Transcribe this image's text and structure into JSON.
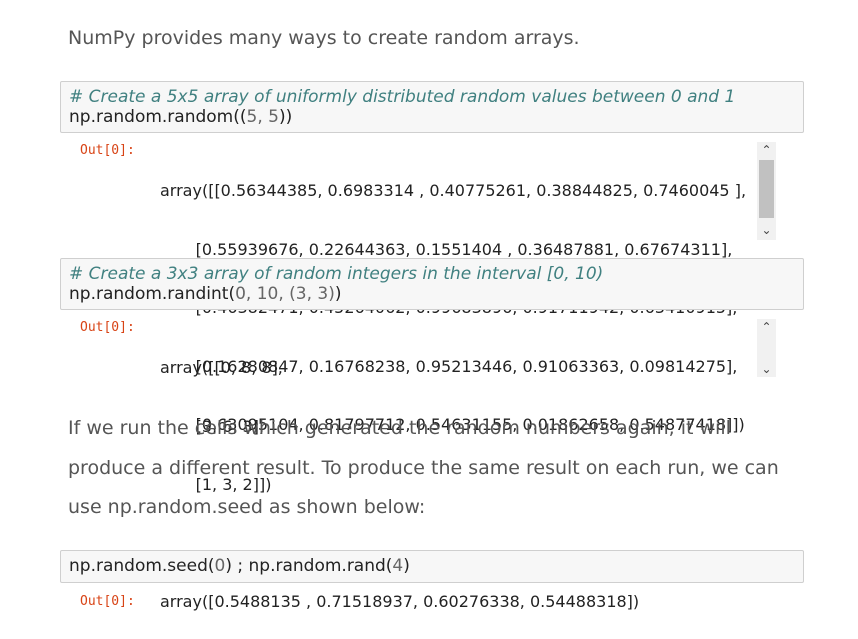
{
  "intro_text": "NumPy provides many ways to create random arrays.",
  "cell1": {
    "comment": "# Create a 5x5 array of uniformly distributed random values between 0 and 1",
    "code_prefix": "np.random.random((",
    "code_nums": "5, 5",
    "code_suffix": "))",
    "out_prompt": "Out[0]:",
    "output_lines": [
      "array([[0.56344385, 0.6983314 , 0.40775261, 0.38844825, 0.7460045 ],",
      "       [0.55939676, 0.22644363, 0.1551404 , 0.36487881, 0.67674311],",
      "       [0.46382471, 0.45264062, 0.99683896, 0.91711942, 0.63410915],",
      "       [0.16280847, 0.16768238, 0.95213446, 0.91063363, 0.09814275],",
      "       [0.63095104, 0.81797712, 0.54631155, 0.01862658, 0.54877418]])"
    ]
  },
  "cell2": {
    "comment": "# Create a 3x3 array of random integers in the interval [0, 10)",
    "code_prefix": "np.random.randint(",
    "code_nums": "0, 10, (3, 3)",
    "code_suffix": ")",
    "out_prompt": "Out[0]:",
    "output_lines": [
      "array([[0, 8, 8],",
      "       [3, 6, 3],",
      "       [1, 3, 2]])"
    ]
  },
  "para2_lines": [
    "If we run the cells which generated the random numbers again, it will",
    "produce a different result. To produce the same result on each run, we can",
    "use np.random.seed as shown below:"
  ],
  "cell3": {
    "code_a": "np.random.seed(",
    "num_a": "0",
    "code_b": ") ; np.random.rand(",
    "num_b": "4",
    "code_c": ")",
    "out_prompt": "Out[0]:",
    "output": "array([0.5488135 , 0.71518937, 0.60276338, 0.54488318])"
  },
  "scroll_up": "⌃",
  "scroll_down": "⌄"
}
